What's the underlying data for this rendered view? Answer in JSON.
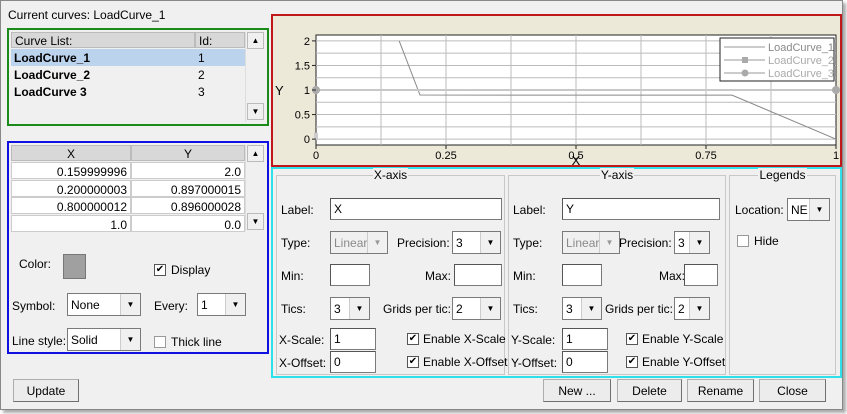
{
  "title": "Current curves: LoadCurve_1",
  "curve_list": {
    "headers": [
      "Curve List:",
      "Id:"
    ],
    "rows": [
      {
        "name": "LoadCurve_1",
        "id": "1"
      },
      {
        "name": "LoadCurve_2",
        "id": "2"
      },
      {
        "name": "LoadCurve  3",
        "id": "3"
      }
    ],
    "selected": 0
  },
  "points": {
    "headers": [
      "X",
      "Y"
    ],
    "rows": [
      [
        "0.159999996",
        "2.0"
      ],
      [
        "0.200000003",
        "0.897000015"
      ],
      [
        "0.800000012",
        "0.896000028"
      ],
      [
        "1.0",
        "0.0"
      ]
    ]
  },
  "props": {
    "color_label": "Color:",
    "color": "#a0a0a0",
    "display_label": "Display",
    "display": true,
    "symbol_label": "Symbol:",
    "symbol": "None",
    "every_label": "Every:",
    "every": "1",
    "line_style_label": "Line style:",
    "line_style": "Solid",
    "thick_label": "Thick line",
    "thick": false
  },
  "chart_data": {
    "type": "line",
    "xlabel": "X",
    "ylabel": "Y",
    "xlim": [
      0,
      1
    ],
    "ylim": [
      -0.12,
      2.12
    ],
    "xticks": [
      "0",
      "0.25",
      "0.5",
      "0.75",
      "1"
    ],
    "yticks": [
      "0",
      "0.5",
      "1",
      "1.5",
      "2"
    ],
    "legend": "top-right",
    "series": [
      {
        "name": "LoadCurve_1",
        "marker": "none",
        "x": [
          0.16,
          0.2,
          0.8,
          1.0
        ],
        "y": [
          2.0,
          0.897,
          0.896,
          0.0
        ]
      },
      {
        "name": "LoadCurve_2",
        "marker": "square",
        "x": [
          0,
          0
        ],
        "y": [
          0,
          0.05
        ]
      },
      {
        "name": "LoadCurve_3",
        "marker": "circle",
        "x": [
          0,
          1
        ],
        "y": [
          1,
          1
        ]
      }
    ]
  },
  "xaxis": {
    "title": "X-axis",
    "label_label": "Label:",
    "label": "X",
    "type_label": "Type:",
    "type": "Linear",
    "precision_label": "Precision:",
    "precision": "3",
    "min_label": "Min:",
    "min": "",
    "max_label": "Max:",
    "max": "",
    "tics_label": "Tics:",
    "tics": "3",
    "grids_label": "Grids per tic:",
    "grids": "2",
    "scale_label": "X-Scale:",
    "scale": "1",
    "offset_label": "X-Offset:",
    "offset": "0",
    "enable_scale": "Enable X-Scale",
    "enable_offset": "Enable X-Offset"
  },
  "yaxis": {
    "title": "Y-axis",
    "label_label": "Label:",
    "label": "Y",
    "type_label": "Type:",
    "type": "Linear",
    "precision_label": "Precision:",
    "precision": "3",
    "min_label": "Min:",
    "min": "",
    "max_label": "Max:",
    "max": "",
    "tics_label": "Tics:",
    "tics": "3",
    "grids_label": "Grids per tic:",
    "grids": "2",
    "scale_label": "Y-Scale:",
    "scale": "1",
    "offset_label": "Y-Offset:",
    "offset": "0",
    "enable_scale": "Enable Y-Scale",
    "enable_offset": "Enable Y-Offset"
  },
  "legends": {
    "title": "Legends",
    "location_label": "Location:",
    "location": "NE",
    "hide_label": "Hide"
  },
  "buttons": {
    "update": "Update",
    "new": "New ...",
    "delete": "Delete",
    "rename": "Rename",
    "close": "Close"
  }
}
